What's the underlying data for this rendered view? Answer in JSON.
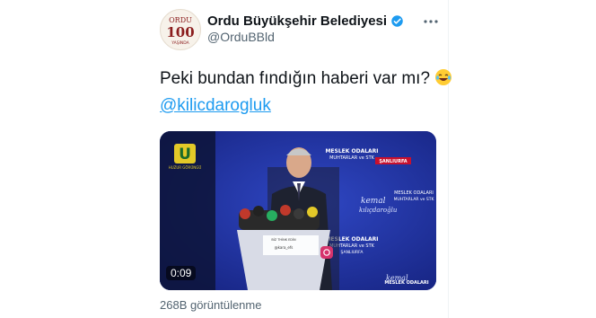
{
  "tweet": {
    "display_name": "Ordu Büyükşehir Belediyesi",
    "handle": "@OrduBBld",
    "text": "Peki bundan fındığın haberi var mı?",
    "emoji_icon": "rolling-on-floor-laughing-emoji",
    "mention": "@kilicdarogluk",
    "views": "268B görüntülenme"
  },
  "video": {
    "duration": "0:09",
    "channel_logo_text": "U",
    "channel_caption": "HUZUR GÖRÜNGÜ",
    "banner_lines": [
      "MESLEK ODALARI",
      "MUHTARLAR ve STK",
      "ŞANLIURFA"
    ],
    "banner_tag": "ŞANLIURFA",
    "script_text": "kemal",
    "script_text2": "kılıçdaroğlu",
    "lower_caption": "BİZ THİNK EDİN",
    "lower_handle": "@kara_efs"
  },
  "avatar": {
    "top_text": "ORDU",
    "number": "100",
    "bottom_text": "YAŞINDA"
  },
  "colors": {
    "link": "#1d9bf0",
    "verified": "#1d9bf0",
    "stage_blue": "#1a2c8c"
  }
}
